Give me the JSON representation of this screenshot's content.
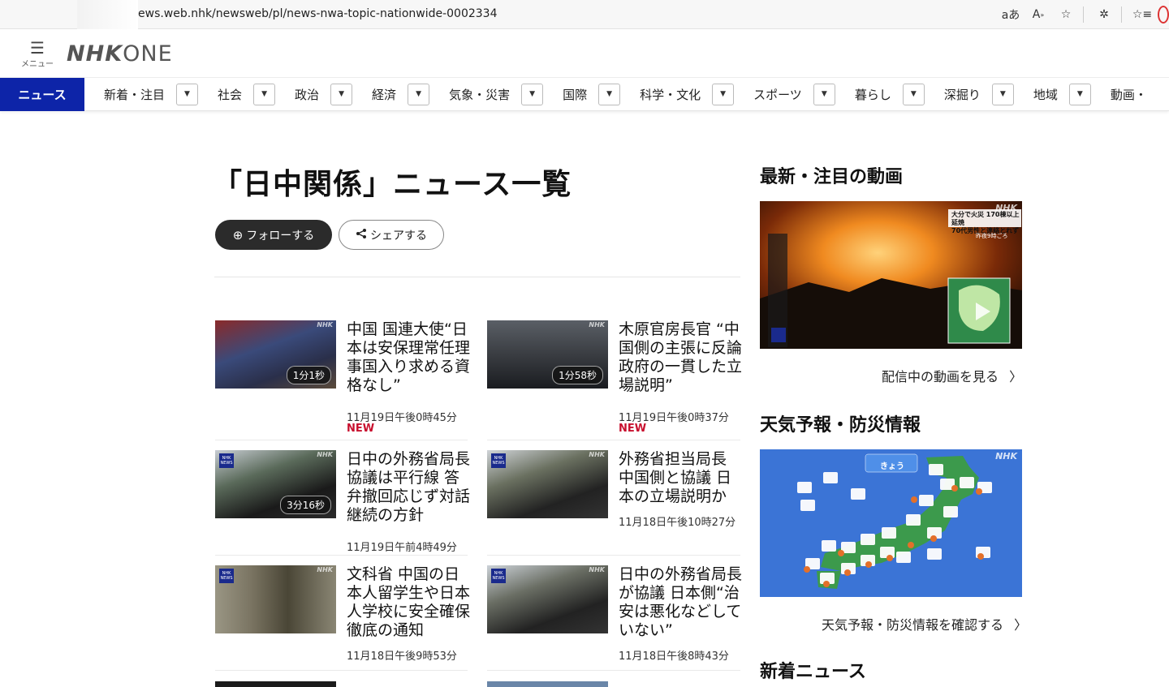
{
  "browser": {
    "url": "ews.web.nhk/newsweb/pl/news-nwa-topic-nationwide-0002334",
    "icons": [
      "read-aloud-font-icon",
      "read-aloud-icon",
      "favorite-star-icon",
      "extensions-icon",
      "favorites-icon"
    ]
  },
  "header": {
    "menu_label": "メニュー",
    "logo_nhk": "NHK",
    "logo_one": "ONE"
  },
  "nav": {
    "active": "ニュース",
    "items": [
      "新着・注目",
      "社会",
      "政治",
      "経済",
      "気象・災害",
      "国際",
      "科学・文化",
      "スポーツ",
      "暮らし",
      "深掘り",
      "地域",
      "動画・"
    ]
  },
  "main": {
    "title": "「日中関係」ニュース一覧",
    "follow_label": "フォローする",
    "share_label": "シェアする",
    "articles": [
      {
        "title": "中国 国連大使“日本は安保理常任理事国入り求める資格なし”",
        "time": "11月19日午後0時45分",
        "duration": "1分1秒",
        "new": "NEW"
      },
      {
        "title": "木原官房長官 “中国側の主張に反論 政府の一貫した立場説明”",
        "time": "11月19日午後0時37分",
        "duration": "1分58秒",
        "new": "NEW"
      },
      {
        "title": "日中の外務省局長協議は平行線 答弁撤回応じず対話継続の方針",
        "time": "11月19日午前4時49分",
        "duration": "3分16秒",
        "new": ""
      },
      {
        "title": "外務省担当局長 中国側と協議 日本の立場説明か",
        "time": "11月18日午後10時27分",
        "duration": "",
        "new": ""
      },
      {
        "title": "文科省 中国の日本人留学生や日本人学校に安全確保徹底の通知",
        "time": "11月18日午後9時53分",
        "duration": "",
        "new": ""
      },
      {
        "title": "日中の外務省局長が協議 日本側“治安は悪化などしていない”",
        "time": "11月18日午後8時43分",
        "duration": "",
        "new": ""
      }
    ],
    "watermark": "NHK",
    "news_badge": "NHK NEWS"
  },
  "sidebar": {
    "video_heading": "最新・注目の動画",
    "video_caption_1": "大分で火災 170棟以上延焼",
    "video_caption_2": "70代男性と連絡とれず",
    "video_caption_3": "昨夜9時ごろ",
    "video_link": "配信中の動画を見る",
    "weather_heading": "天気予報・防災情報",
    "weather_tab": "きょう",
    "weather_link": "天気予報・防災情報を確認する",
    "latest_heading": "新着ニュース"
  },
  "colors": {
    "brand": "#0d24a8",
    "new": "#c8102e",
    "follow_bg": "#2b2b2b"
  }
}
